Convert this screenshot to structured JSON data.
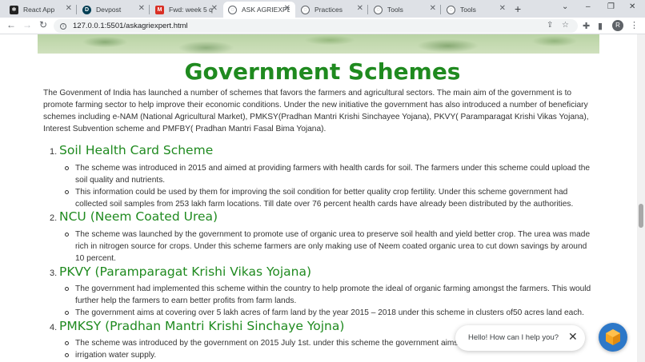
{
  "browser": {
    "tabs": [
      {
        "label": "React App",
        "icon": "react-icon",
        "color": "#222222"
      },
      {
        "label": "Devpost",
        "icon": "devpost-icon",
        "color": "#003e54"
      },
      {
        "label": "Fwd: week 5 q",
        "icon": "gmail-icon",
        "color": "#d93025"
      },
      {
        "label": "ASK AGRIEXPE",
        "icon": "globe-icon",
        "color": "#5f6368"
      },
      {
        "label": "Practices",
        "icon": "globe-icon",
        "color": "#5f6368"
      },
      {
        "label": "Tools",
        "icon": "globe-icon",
        "color": "#5f6368"
      },
      {
        "label": "Tools",
        "icon": "globe-icon",
        "color": "#5f6368"
      }
    ],
    "url": "127.0.0.1:5501/askagriexpert.html",
    "profile_initial": "R"
  },
  "page": {
    "title": "Government Schemes",
    "intro": "The Govenment of India has launched a number of schemes that favors the farmers and agricultural sectors. The main aim of the government is to promote farming sector to help improve their economic conditions. Under the new initiative the government has also introduced a number of beneficiary schemes including e-NAM (National Agricultural Market), PMKSY(Pradhan Mantri Krishi Sinchayee Yojana), PKVY( Paramparagat Krishi Vikas Yojana), Interest Subvention scheme and PMFBY( Pradhan Mantri Fasal Bima Yojana).",
    "schemes": [
      {
        "num": "1.",
        "name": "Soil Health Card Scheme",
        "points": [
          "The scheme was introduced in 2015 and aimed at providing farmers with health cards for soil. The farmers under this scheme could upload the soil quality and nutrients.",
          "This information could be used by them for improving the soil condition for better quality crop fertility. Under this scheme government had collected soil samples from 253 lakh farm locations. Till date over 76 percent health cards have already been distributed by the authorities."
        ]
      },
      {
        "num": "2.",
        "name": "NCU (Neem Coated Urea)",
        "points": [
          "The scheme was launched by the government to promote use of organic urea to preserve soil health and yield better crop. The urea was made rich in nitrogen source for crops. Under this scheme farmers are only making use of Neem coated organic urea to cut down savings by around 10 percent."
        ]
      },
      {
        "num": "3.",
        "name": "PKVY (Paramparagat Krishi Vikas Yojana)",
        "points": [
          "The government had implemented this scheme within the country to help promote the ideal of organic farming amongst the farmers. This would further help the farmers to earn better profits from farm lands.",
          "The government aims at covering over 5 lakh acres of farm land by the year 2015 – 2018 under this scheme in clusters of50 acres land each."
        ]
      },
      {
        "num": "4.",
        "name": "PMKSY (Pradhan Mantri Krishi Sinchaye Yojna)",
        "points": [
          "The scheme was introduced by the government on 2015 July 1st. under this scheme the government aims",
          "irrigation water supply."
        ]
      }
    ]
  },
  "chat": {
    "prompt": "Hello! How can I help you?",
    "close": "✕"
  }
}
